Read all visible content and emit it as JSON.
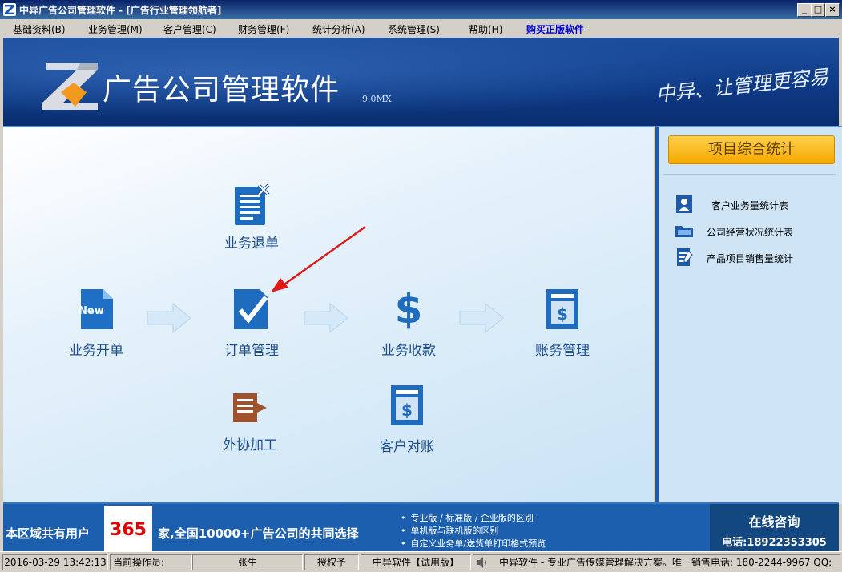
{
  "window": {
    "title": "中异广告公司管理软件 - [广告行业管理领航者]"
  },
  "menu": [
    {
      "label": "基础资料(B)"
    },
    {
      "label": "业务管理(M)"
    },
    {
      "label": "客户管理(C)"
    },
    {
      "label": "财务管理(F)"
    },
    {
      "label": "统计分析(A)"
    },
    {
      "label": "系统管理(S)"
    },
    {
      "label": "帮助(H)"
    },
    {
      "label": "购买正版软件",
      "color": "#0000cc"
    }
  ],
  "banner": {
    "title": "广告公司管理软件",
    "version": "9.0MX",
    "slogan": "中异、让管理更容易"
  },
  "workflow": {
    "refund": "业务退单",
    "new_order": "业务开单",
    "new_badge": "New",
    "order_mgmt": "订单管理",
    "collection": "业务收款",
    "accounts": "账务管理",
    "outsourcing": "外协加工",
    "reconcile": "客户对账"
  },
  "right": {
    "stats_button": "项目综合统计",
    "items": [
      {
        "label": "客户业务量统计表",
        "icon": "person-icon"
      },
      {
        "label": "公司经营状况统计表",
        "icon": "folder-icon"
      },
      {
        "label": "产品项目销售量统计",
        "icon": "document-icon"
      }
    ]
  },
  "bottom": {
    "count_prefix": "本区域共有用户",
    "count": "365",
    "count_suffix": "家,全国10000+广告公司的共同选择",
    "links": [
      "专业版 / 标准版 / 企业版的区别",
      "单机版与联机版的区别",
      "自定义业务单/送货单打印格式预览"
    ],
    "consult_title": "在线咨询",
    "consult_phone": "电话:18922353305"
  },
  "status": {
    "datetime": "2016-03-29 13:42:13",
    "operator_label": "当前操作员:",
    "operator": "张生",
    "license": "授权予",
    "edition": "中异软件【试用版】",
    "marquee": "中异软件 - 专业广告传媒管理解决方案。唯一销售电话: 180-2244-9967 QQ:"
  },
  "colors": {
    "accent": "#1c5fae",
    "titlebar": "#0a246a",
    "stats_button": "#f5a800",
    "count": "#e00000"
  }
}
